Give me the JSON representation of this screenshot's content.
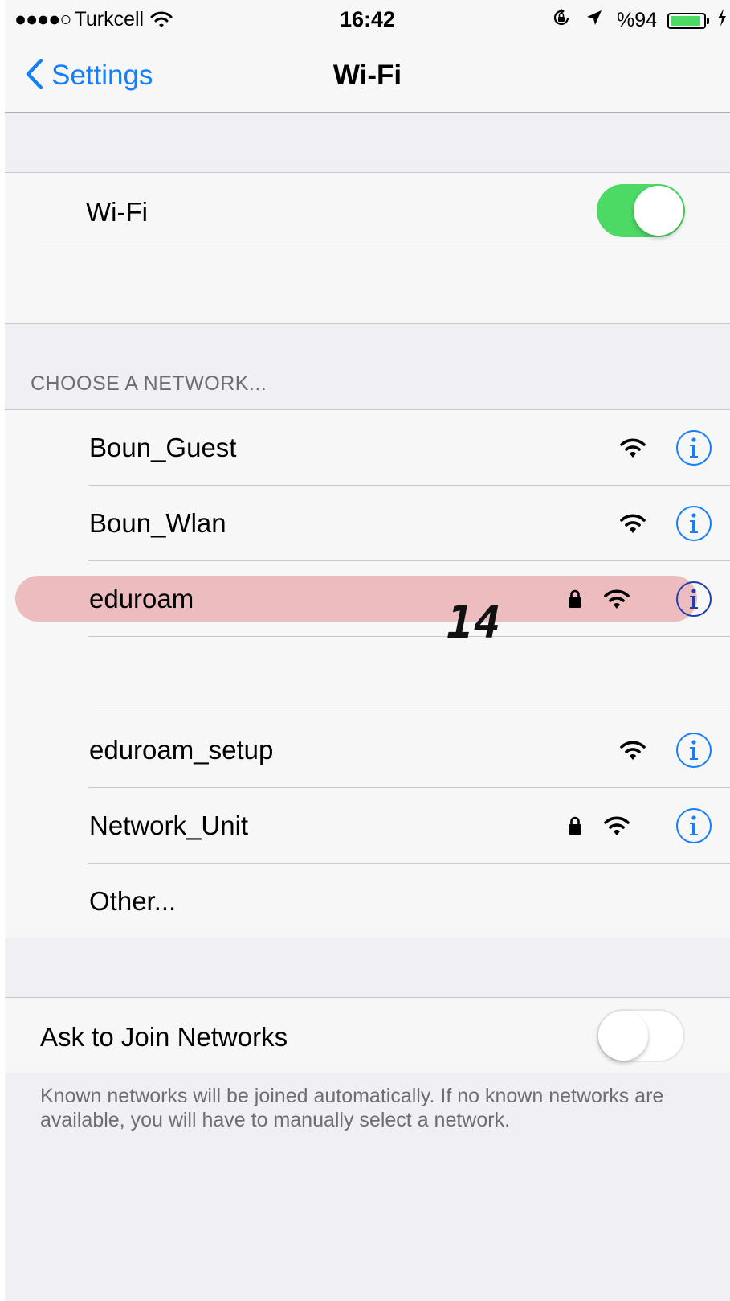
{
  "status_bar": {
    "signal": "●●●●○",
    "carrier": "Turkcell",
    "time": "16:42",
    "battery_percent": "%94",
    "battery_level": 0.94
  },
  "nav": {
    "back_label": "Settings",
    "title": "Wi-Fi"
  },
  "wifi_toggle": {
    "label": "Wi-Fi",
    "on": true
  },
  "networks_section": {
    "header": "CHOOSE A NETWORK..."
  },
  "networks": [
    {
      "name": "Boun_Guest",
      "locked": false
    },
    {
      "name": "Boun_Wlan",
      "locked": false
    },
    {
      "name": "eduroam",
      "locked": true
    },
    {
      "name": "eduroam_setup",
      "locked": false
    },
    {
      "name": "Network_Unit",
      "locked": true
    }
  ],
  "other_label": "Other...",
  "ask_to_join": {
    "label": "Ask to Join Networks",
    "on": false,
    "footer": "Known networks will be joined automatically. If no known networks are available, you will have to manually select a network."
  },
  "annotation": {
    "marker": "14"
  },
  "colors": {
    "accent": "#157efb",
    "switch_on": "#4cd964",
    "highlight": "#ecbcbe"
  }
}
